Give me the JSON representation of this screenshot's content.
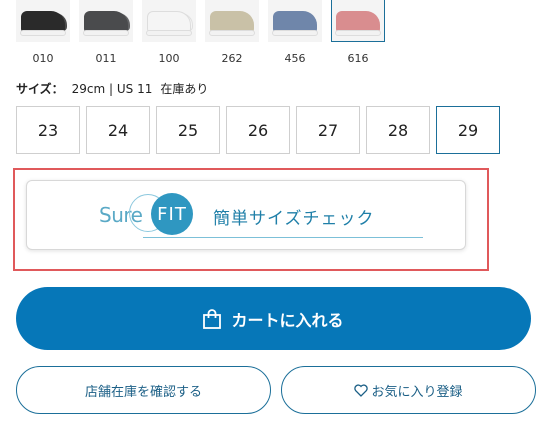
{
  "swatches": [
    {
      "code": "010",
      "color": "#2a2a2a",
      "selected": false
    },
    {
      "code": "011",
      "color": "#4a4b4d",
      "selected": false
    },
    {
      "code": "100",
      "color": "#f5f5f5",
      "selected": false
    },
    {
      "code": "262",
      "color": "#c9c1a7",
      "selected": false
    },
    {
      "code": "456",
      "color": "#6f86aa",
      "selected": false
    },
    {
      "code": "616",
      "color": "#d98d8f",
      "selected": true
    }
  ],
  "size_info": {
    "label": "サイズ：",
    "value": "29cm | US 11",
    "stock": "在庫あり"
  },
  "sizes": [
    "23",
    "24",
    "25",
    "26",
    "27",
    "28",
    "29"
  ],
  "selected_size": "29",
  "surefit": {
    "logo_sure": "Sure",
    "logo_fit": "FIT",
    "title": "簡単サイズチェック"
  },
  "cart_button": {
    "label": "カートに入れる"
  },
  "store_stock_button": {
    "label": "店舗在庫を確認する"
  },
  "favorite_button": {
    "label": "お気に入り登録"
  },
  "colors": {
    "primary": "#0677b8",
    "highlight": "#e0595b",
    "surefit_accent": "#2f97c1"
  }
}
